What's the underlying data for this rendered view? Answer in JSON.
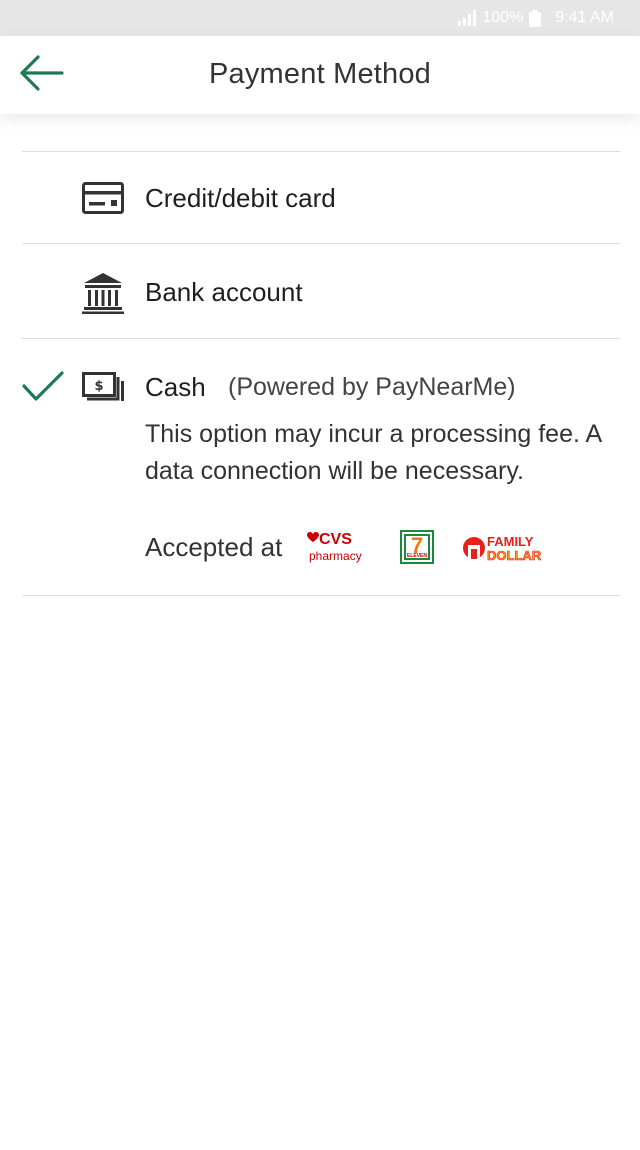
{
  "status_bar": {
    "battery": "100%",
    "time": "9:41 AM"
  },
  "header": {
    "title": "Payment Method",
    "back_icon": "arrow-left-icon"
  },
  "options": [
    {
      "label": "Credit/debit card",
      "icon": "credit-card-icon",
      "selected": false
    },
    {
      "label": "Bank account",
      "icon": "bank-icon",
      "selected": false
    },
    {
      "label": "Cash",
      "icon": "cash-icon",
      "selected": true,
      "powered_by": "(Powered by PayNearMe)",
      "description": "This option may incur a processing fee. A data connection will be necessary.",
      "accepted_label": "Accepted at",
      "merchants": [
        {
          "name": "CVS pharmacy",
          "top": "CVS",
          "bottom": "pharmacy"
        },
        {
          "name": "7-Eleven",
          "top": "7",
          "bottom": "ELEVEN"
        },
        {
          "name": "Family Dollar",
          "top": "FAMILY",
          "bottom": "DOLLAR"
        }
      ]
    }
  ],
  "colors": {
    "accent": "#1e7a52",
    "check": "#1e7a52",
    "cvs_red": "#cc0000",
    "seven_green": "#1a8a3a",
    "seven_orange": "#f07a16",
    "family_dollar_red": "#e8201c",
    "family_dollar_orange": "#f5a01a"
  }
}
